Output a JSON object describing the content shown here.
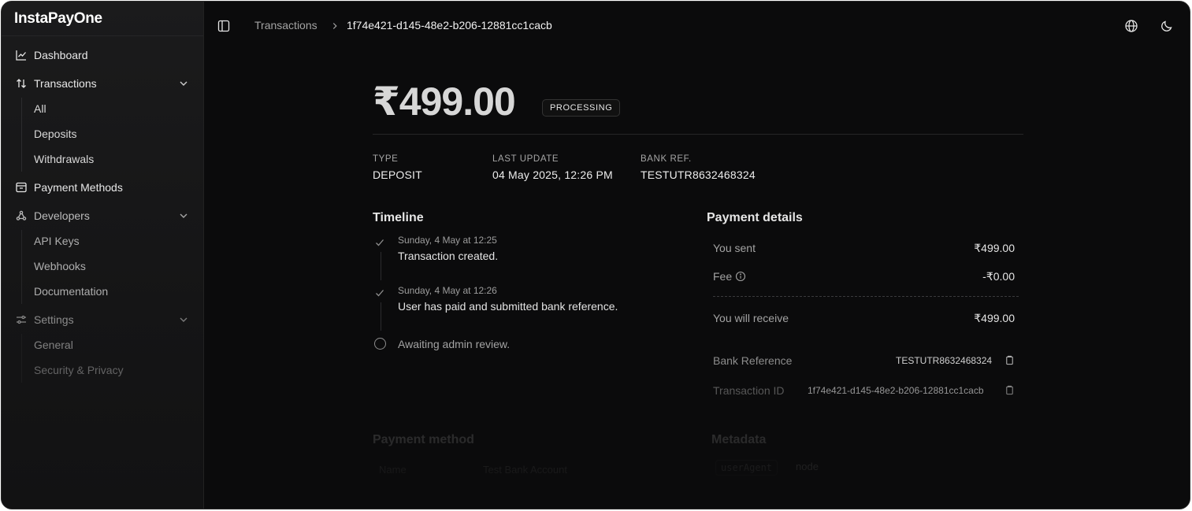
{
  "app": {
    "brand": "InstaPayOne"
  },
  "sidebar": {
    "items": [
      {
        "label": "Dashboard",
        "icon": "chart-line-icon"
      },
      {
        "label": "Transactions",
        "icon": "arrows-up-down-icon",
        "children": [
          "All",
          "Deposits",
          "Withdrawals"
        ]
      },
      {
        "label": "Payment Methods",
        "icon": "archive-box-icon"
      },
      {
        "label": "Developers",
        "icon": "webhook-icon",
        "children": [
          "API Keys",
          "Webhooks",
          "Documentation"
        ]
      },
      {
        "label": "Settings",
        "icon": "sliders-icon",
        "children": [
          "General",
          "Security & Privacy"
        ]
      }
    ]
  },
  "header": {
    "breadcrumb": {
      "parent": "Transactions",
      "current": "1f74e421-d145-48e2-b206-12881cc1cacb"
    },
    "icons": [
      "sidebar-toggle-icon",
      "globe-icon",
      "moon-icon"
    ]
  },
  "transaction": {
    "amount": "₹499.00",
    "status": "PROCESSING",
    "meta": [
      {
        "label": "TYPE",
        "value": "DEPOSIT"
      },
      {
        "label": "LAST UPDATE",
        "value": "04 May 2025, 12:26 PM"
      },
      {
        "label": "BANK REF.",
        "value": "TESTUTR8632468324"
      }
    ]
  },
  "timeline": {
    "title": "Timeline",
    "events": [
      {
        "time": "Sunday, 4 May at 12:25",
        "text": "Transaction created.",
        "done": true
      },
      {
        "time": "Sunday, 4 May at 12:26",
        "text": "User has paid and submitted bank reference.",
        "done": true
      },
      {
        "time": "",
        "text": "Awaiting admin review.",
        "done": false
      }
    ]
  },
  "payment_details": {
    "title": "Payment details",
    "you_sent": {
      "label": "You sent",
      "value": "₹499.00"
    },
    "fee": {
      "label": "Fee",
      "value": "-₹0.00"
    },
    "you_will_receive": {
      "label": "You will receive",
      "value": "₹499.00"
    },
    "bank_reference": {
      "label": "Bank Reference",
      "value": "TESTUTR8632468324"
    },
    "transaction_id": {
      "label": "Transaction ID",
      "value": "1f74e421-d145-48e2-b206-12881cc1cacb"
    }
  },
  "payment_method": {
    "title": "Payment method",
    "name_label": "Name",
    "name_value": "Test Bank Account"
  },
  "metadata": {
    "title": "Metadata",
    "key": "userAgent",
    "value": "node"
  },
  "colors": {
    "background": "#0b0b0c",
    "sidebar": "#1b1b1c",
    "text": "#e6e6e6",
    "muted": "#a3a3a3"
  }
}
